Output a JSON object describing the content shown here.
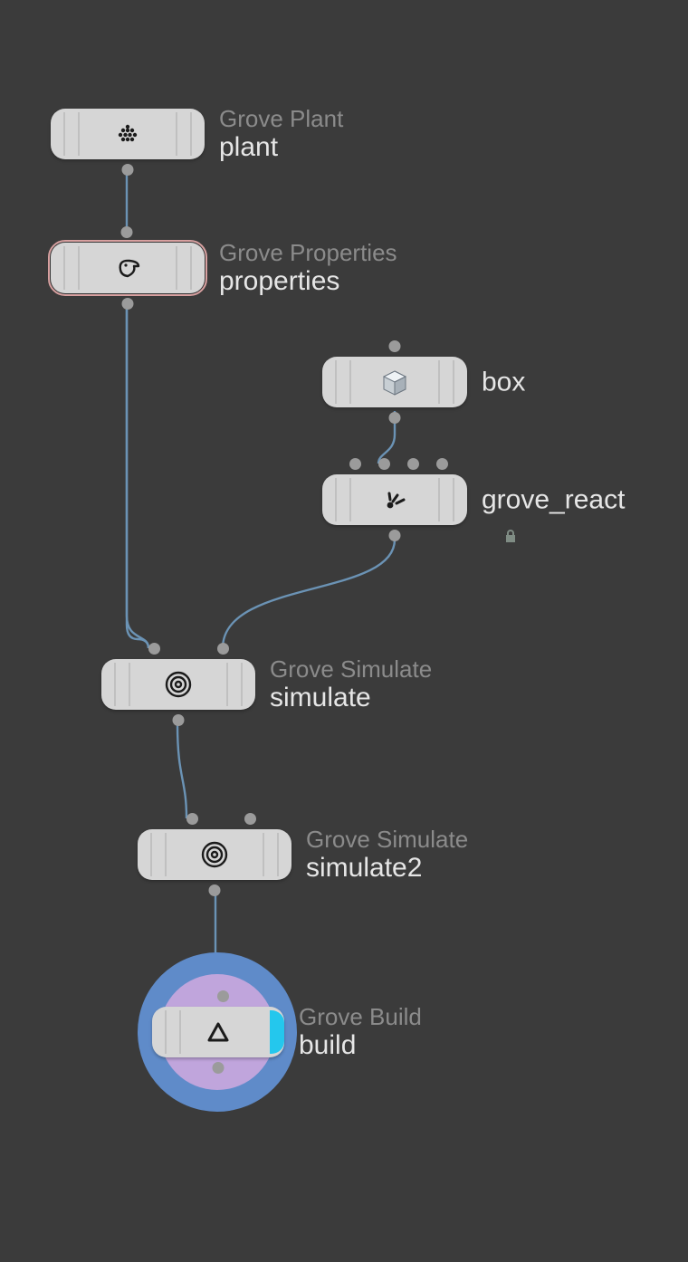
{
  "nodes": {
    "plant": {
      "type": "Grove Plant",
      "name": "plant"
    },
    "properties": {
      "type": "Grove Properties",
      "name": "properties"
    },
    "box": {
      "type": "",
      "name": "box"
    },
    "react": {
      "type": "",
      "name": "grove_react"
    },
    "simulate": {
      "type": "Grove Simulate",
      "name": "simulate"
    },
    "simulate2": {
      "type": "Grove Simulate",
      "name": "simulate2"
    },
    "build": {
      "type": "Grove Build",
      "name": "build"
    }
  },
  "selected_node": "properties",
  "locked_node": "react",
  "display_flag": "build",
  "connections": [
    {
      "from": "plant",
      "to": "properties"
    },
    {
      "from": "properties",
      "to": "simulate",
      "to_port": 0
    },
    {
      "from": "box",
      "to": "react",
      "to_port": 1
    },
    {
      "from": "react",
      "to": "simulate",
      "to_port": 1
    },
    {
      "from": "simulate",
      "to": "simulate2",
      "to_port": 0
    },
    {
      "from": "simulate2",
      "to": "build"
    }
  ],
  "colors": {
    "canvas_bg": "#3b3b3b",
    "node_bg": "#d6d6d6",
    "port": "#9b9b9b",
    "wire": "#6b93b5",
    "selection": "#d7a0a0",
    "ring_outer": "#5f8bc9",
    "ring_inner": "#c0a5dc",
    "cyan_tab": "#24c7ed"
  }
}
